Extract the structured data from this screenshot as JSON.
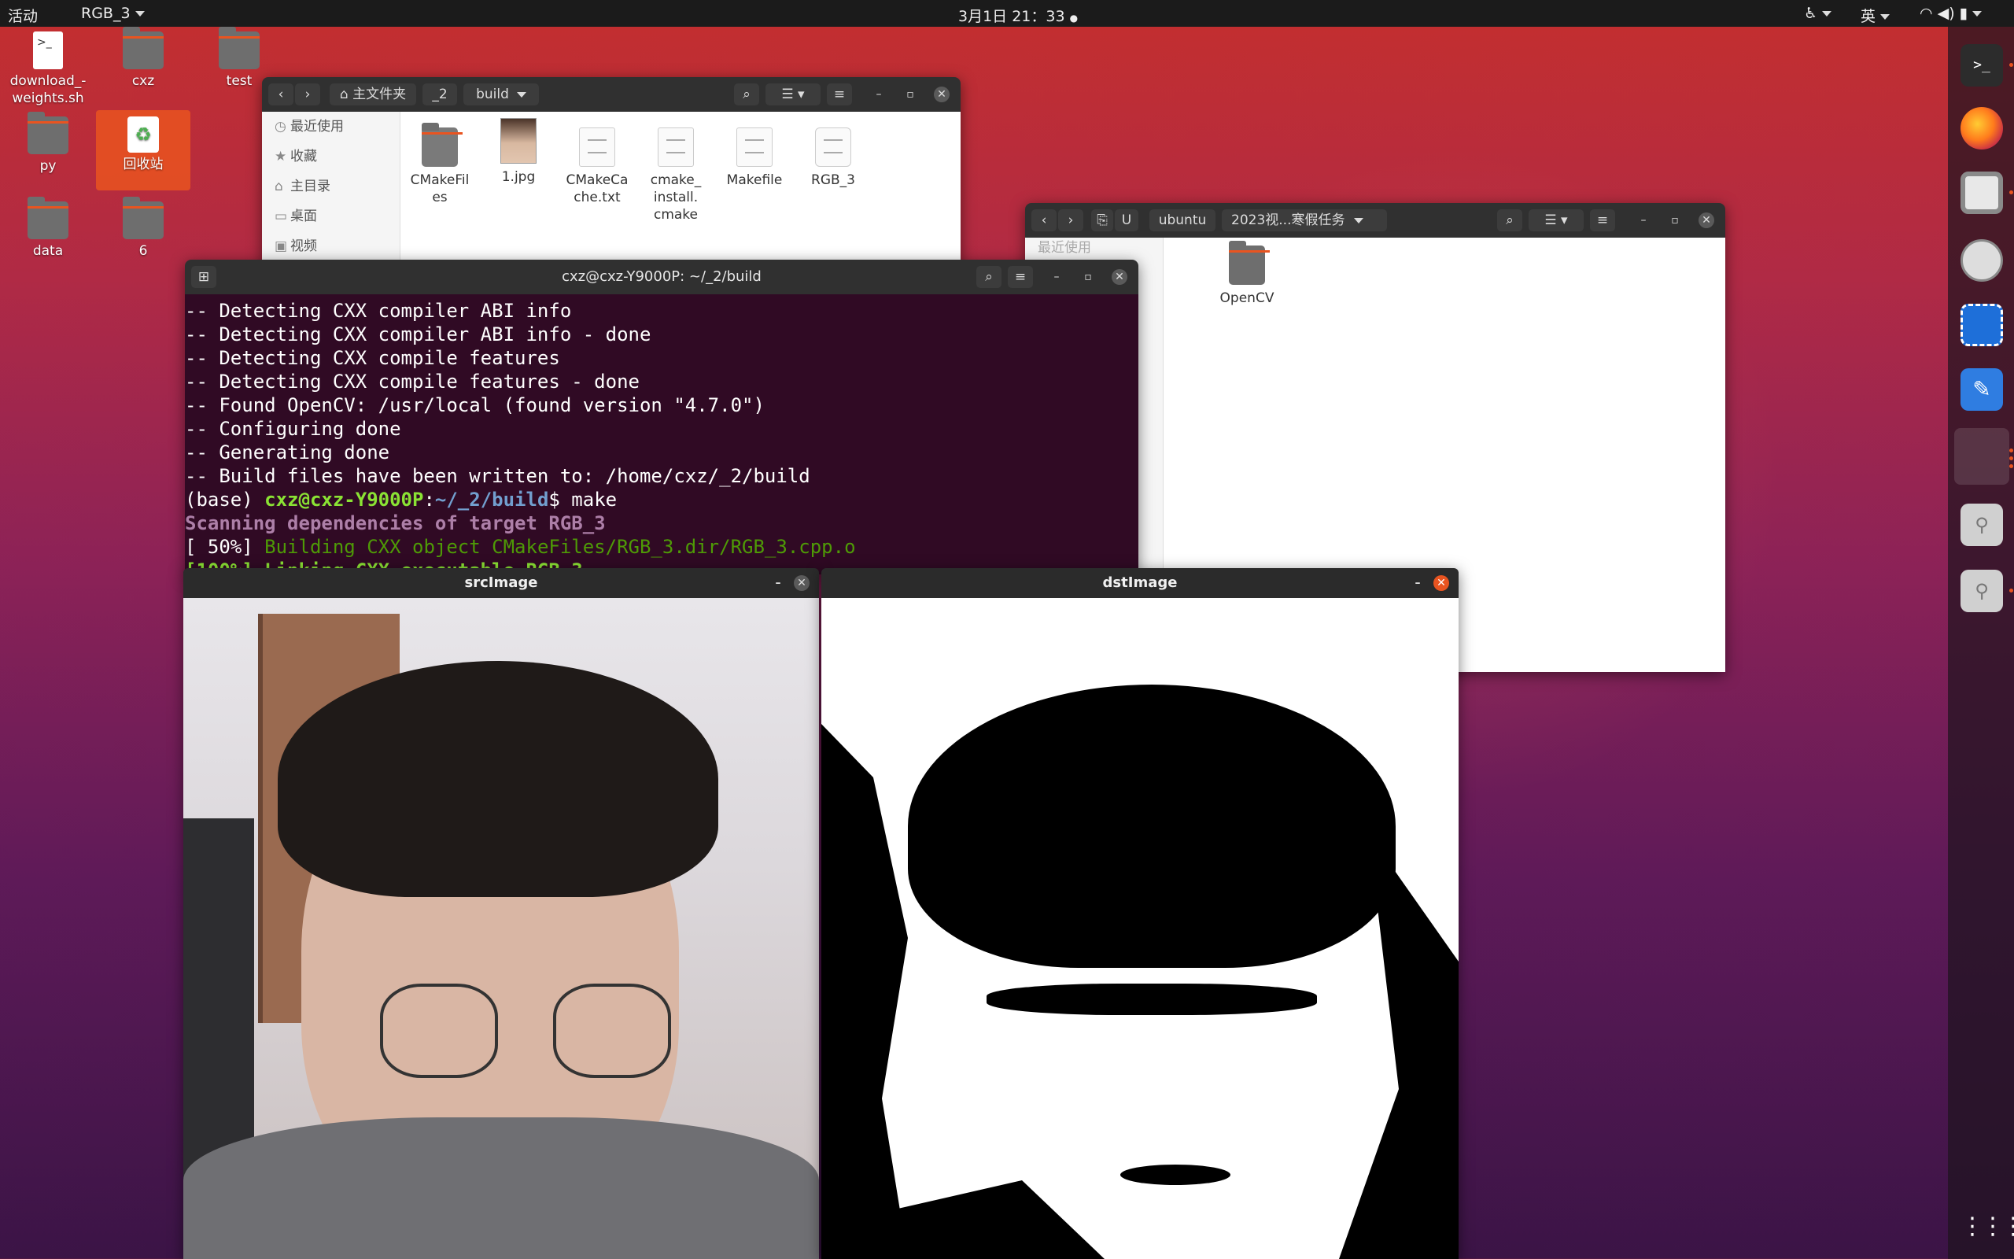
{
  "topbar": {
    "activities": "活动",
    "app_menu": "RGB_3",
    "clock": "3月1日  21：33",
    "input_method": "英"
  },
  "desktop_icons": [
    {
      "label": "download_-weights.sh",
      "icon": "script-file-icon"
    },
    {
      "label": "cxz",
      "icon": "home-folder-icon"
    },
    {
      "label": "test",
      "icon": "folder-icon"
    },
    {
      "label": "py",
      "icon": "folder-icon"
    },
    {
      "label": "回收站",
      "icon": "trash-icon"
    },
    {
      "label": "data",
      "icon": "folder-icon"
    },
    {
      "label": "6",
      "icon": "folder-icon"
    }
  ],
  "file_manager_build": {
    "path_home": "主文件夹",
    "path_2": "_2",
    "path_build": "build",
    "sidebar": [
      "最近使用",
      "收藏",
      "主目录",
      "桌面",
      "视频"
    ],
    "files": [
      {
        "name": "CMakeFiles",
        "kind": "folder"
      },
      {
        "name": "1.jpg",
        "kind": "image"
      },
      {
        "name": "CMakeCache.txt",
        "kind": "text"
      },
      {
        "name": "cmake_install.cmake",
        "kind": "script"
      },
      {
        "name": "Makefile",
        "kind": "script"
      },
      {
        "name": "RGB_3",
        "kind": "executable"
      }
    ]
  },
  "file_manager_usb": {
    "path_u": "U",
    "path_ubuntu": "ubuntu",
    "path_folder": "2023视...寒假任务",
    "sidebar_partial": "最近使用",
    "files": [
      {
        "name": "OpenCV",
        "kind": "folder"
      }
    ]
  },
  "terminal": {
    "title": "cxz@cxz-Y9000P: ~/_2/build",
    "lines": [
      "-- Detecting CXX compiler ABI info",
      "-- Detecting CXX compiler ABI info - done",
      "-- Detecting CXX compile features",
      "-- Detecting CXX compile features - done",
      "-- Found OpenCV: /usr/local (found version \"4.7.0\")",
      "-- Configuring done",
      "-- Generating done",
      "-- Build files have been written to: /home/cxz/_2/build"
    ],
    "prompt_base": "(base) ",
    "prompt_user": "cxz@cxz-Y9000P",
    "prompt_colon": ":",
    "prompt_path": "~/_2/build",
    "prompt_cmd": "$ make",
    "scan_line": "Scanning dependencies of target RGB_3",
    "build_pct": "[ 50%] ",
    "build_msg": "Building CXX object CMakeFiles/RGB_3.dir/RGB_3.cpp.o",
    "link_line": "[100%] Linking CXX executable RGB_3"
  },
  "src_window": {
    "title": "srcImage"
  },
  "dst_window": {
    "title": "dstImage"
  },
  "colors": {
    "accent": "#e95420",
    "terminal_bg": "#300a24",
    "prompt_green": "#8ae234",
    "prompt_blue": "#729fcf"
  }
}
